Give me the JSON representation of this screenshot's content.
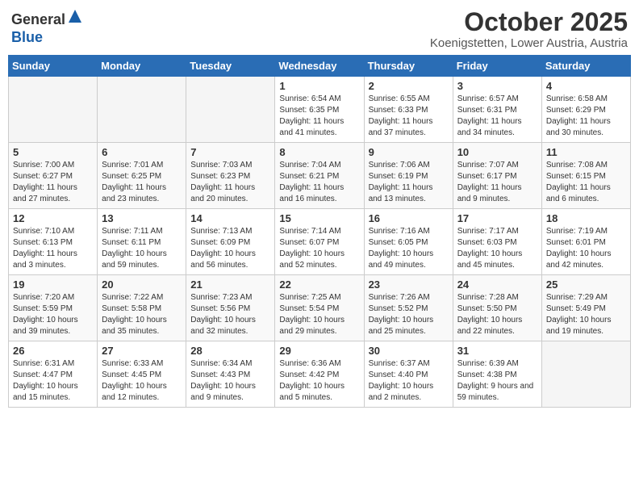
{
  "header": {
    "logo_general": "General",
    "logo_blue": "Blue",
    "month_title": "October 2025",
    "location": "Koenigstetten, Lower Austria, Austria"
  },
  "days_of_week": [
    "Sunday",
    "Monday",
    "Tuesday",
    "Wednesday",
    "Thursday",
    "Friday",
    "Saturday"
  ],
  "weeks": [
    {
      "days": [
        {
          "num": "",
          "empty": true
        },
        {
          "num": "",
          "empty": true
        },
        {
          "num": "",
          "empty": true
        },
        {
          "num": "1",
          "sunrise": "6:54 AM",
          "sunset": "6:35 PM",
          "daylight": "11 hours and 41 minutes."
        },
        {
          "num": "2",
          "sunrise": "6:55 AM",
          "sunset": "6:33 PM",
          "daylight": "11 hours and 37 minutes."
        },
        {
          "num": "3",
          "sunrise": "6:57 AM",
          "sunset": "6:31 PM",
          "daylight": "11 hours and 34 minutes."
        },
        {
          "num": "4",
          "sunrise": "6:58 AM",
          "sunset": "6:29 PM",
          "daylight": "11 hours and 30 minutes."
        }
      ]
    },
    {
      "days": [
        {
          "num": "5",
          "sunrise": "7:00 AM",
          "sunset": "6:27 PM",
          "daylight": "11 hours and 27 minutes."
        },
        {
          "num": "6",
          "sunrise": "7:01 AM",
          "sunset": "6:25 PM",
          "daylight": "11 hours and 23 minutes."
        },
        {
          "num": "7",
          "sunrise": "7:03 AM",
          "sunset": "6:23 PM",
          "daylight": "11 hours and 20 minutes."
        },
        {
          "num": "8",
          "sunrise": "7:04 AM",
          "sunset": "6:21 PM",
          "daylight": "11 hours and 16 minutes."
        },
        {
          "num": "9",
          "sunrise": "7:06 AM",
          "sunset": "6:19 PM",
          "daylight": "11 hours and 13 minutes."
        },
        {
          "num": "10",
          "sunrise": "7:07 AM",
          "sunset": "6:17 PM",
          "daylight": "11 hours and 9 minutes."
        },
        {
          "num": "11",
          "sunrise": "7:08 AM",
          "sunset": "6:15 PM",
          "daylight": "11 hours and 6 minutes."
        }
      ]
    },
    {
      "days": [
        {
          "num": "12",
          "sunrise": "7:10 AM",
          "sunset": "6:13 PM",
          "daylight": "11 hours and 3 minutes."
        },
        {
          "num": "13",
          "sunrise": "7:11 AM",
          "sunset": "6:11 PM",
          "daylight": "10 hours and 59 minutes."
        },
        {
          "num": "14",
          "sunrise": "7:13 AM",
          "sunset": "6:09 PM",
          "daylight": "10 hours and 56 minutes."
        },
        {
          "num": "15",
          "sunrise": "7:14 AM",
          "sunset": "6:07 PM",
          "daylight": "10 hours and 52 minutes."
        },
        {
          "num": "16",
          "sunrise": "7:16 AM",
          "sunset": "6:05 PM",
          "daylight": "10 hours and 49 minutes."
        },
        {
          "num": "17",
          "sunrise": "7:17 AM",
          "sunset": "6:03 PM",
          "daylight": "10 hours and 45 minutes."
        },
        {
          "num": "18",
          "sunrise": "7:19 AM",
          "sunset": "6:01 PM",
          "daylight": "10 hours and 42 minutes."
        }
      ]
    },
    {
      "days": [
        {
          "num": "19",
          "sunrise": "7:20 AM",
          "sunset": "5:59 PM",
          "daylight": "10 hours and 39 minutes."
        },
        {
          "num": "20",
          "sunrise": "7:22 AM",
          "sunset": "5:58 PM",
          "daylight": "10 hours and 35 minutes."
        },
        {
          "num": "21",
          "sunrise": "7:23 AM",
          "sunset": "5:56 PM",
          "daylight": "10 hours and 32 minutes."
        },
        {
          "num": "22",
          "sunrise": "7:25 AM",
          "sunset": "5:54 PM",
          "daylight": "10 hours and 29 minutes."
        },
        {
          "num": "23",
          "sunrise": "7:26 AM",
          "sunset": "5:52 PM",
          "daylight": "10 hours and 25 minutes."
        },
        {
          "num": "24",
          "sunrise": "7:28 AM",
          "sunset": "5:50 PM",
          "daylight": "10 hours and 22 minutes."
        },
        {
          "num": "25",
          "sunrise": "7:29 AM",
          "sunset": "5:49 PM",
          "daylight": "10 hours and 19 minutes."
        }
      ]
    },
    {
      "days": [
        {
          "num": "26",
          "sunrise": "6:31 AM",
          "sunset": "4:47 PM",
          "daylight": "10 hours and 15 minutes."
        },
        {
          "num": "27",
          "sunrise": "6:33 AM",
          "sunset": "4:45 PM",
          "daylight": "10 hours and 12 minutes."
        },
        {
          "num": "28",
          "sunrise": "6:34 AM",
          "sunset": "4:43 PM",
          "daylight": "10 hours and 9 minutes."
        },
        {
          "num": "29",
          "sunrise": "6:36 AM",
          "sunset": "4:42 PM",
          "daylight": "10 hours and 5 minutes."
        },
        {
          "num": "30",
          "sunrise": "6:37 AM",
          "sunset": "4:40 PM",
          "daylight": "10 hours and 2 minutes."
        },
        {
          "num": "31",
          "sunrise": "6:39 AM",
          "sunset": "4:38 PM",
          "daylight": "9 hours and 59 minutes."
        },
        {
          "num": "",
          "empty": true
        }
      ]
    }
  ],
  "labels": {
    "sunrise": "Sunrise:",
    "sunset": "Sunset:",
    "daylight": "Daylight:"
  }
}
